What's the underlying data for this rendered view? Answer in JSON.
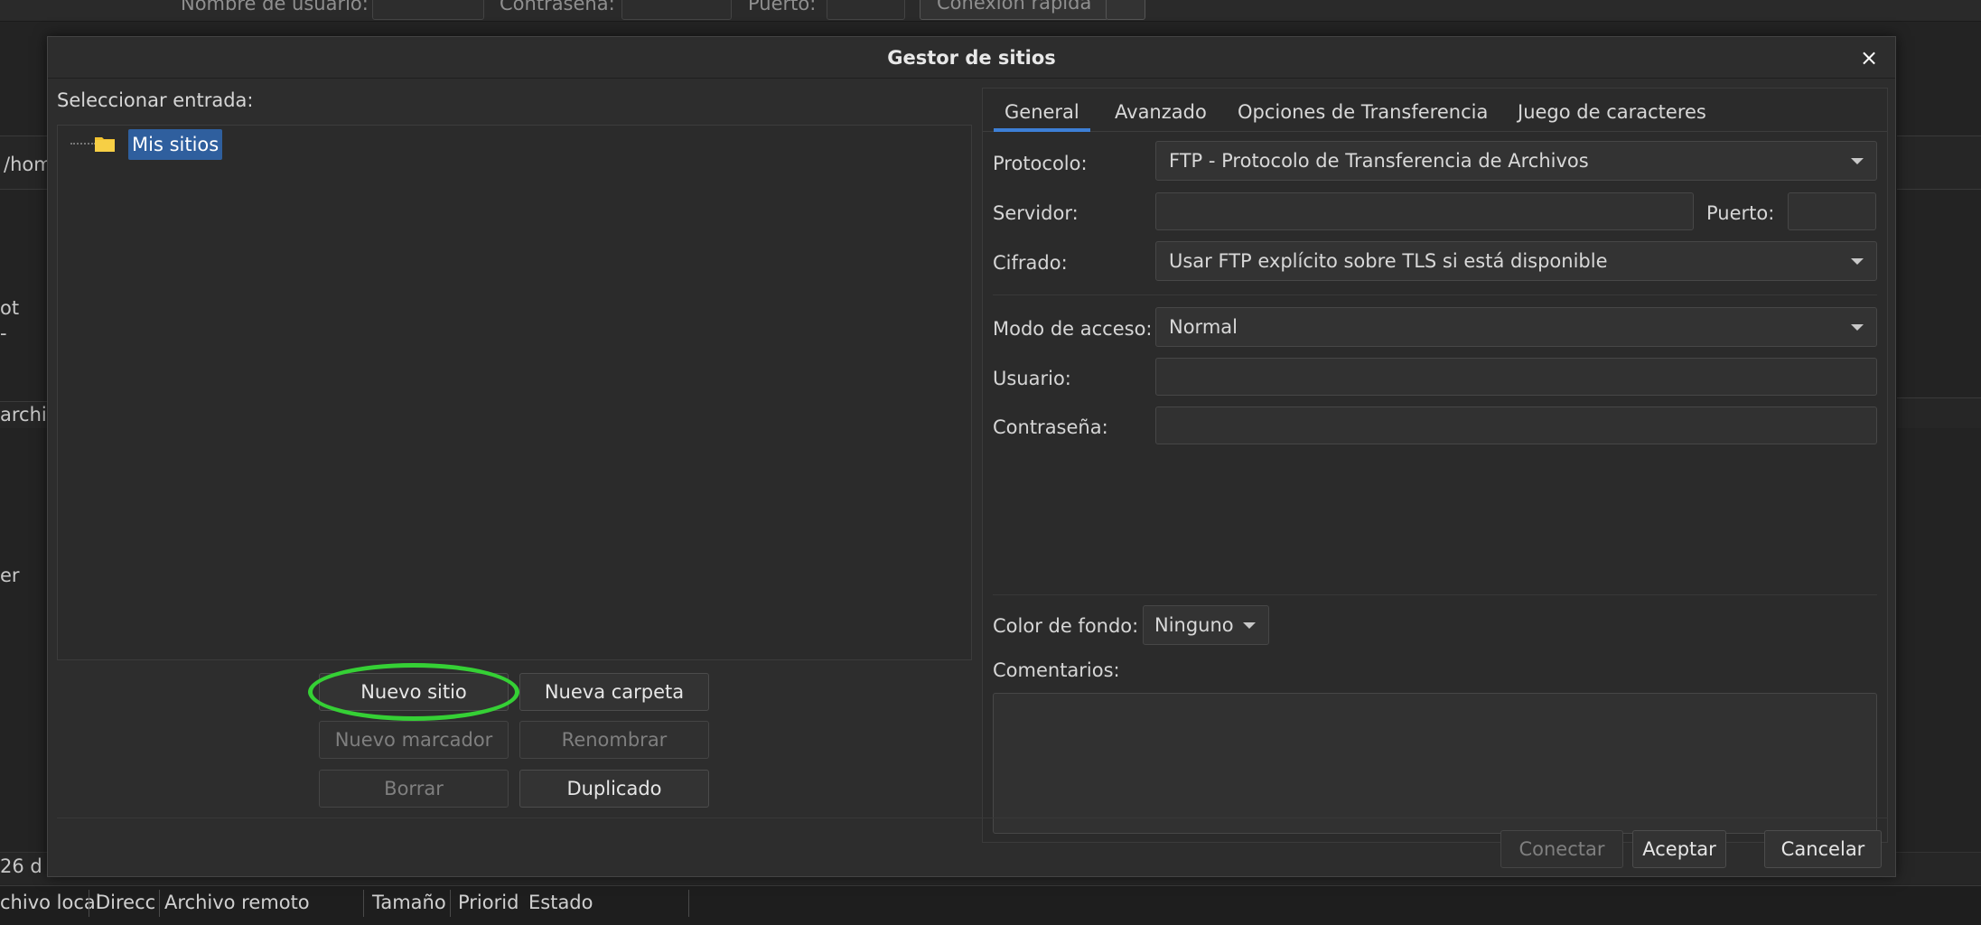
{
  "background": {
    "top_labels": [
      "Nombre de usuario:",
      "Contraseña:",
      "Puerto:"
    ],
    "quick_connect": "Conexión rápida",
    "path_fragment": "/hom",
    "side_fragments": [
      "ot",
      "-",
      "archi",
      "er",
      "26 d"
    ],
    "columns": [
      "chivo local",
      "Direcc",
      "Archivo remoto",
      "Tamaño",
      "Priorid",
      "Estado"
    ]
  },
  "dialog": {
    "title": "Gestor de sitios",
    "close_glyph": "×",
    "select_entry_label": "Seleccionar entrada:",
    "tree": {
      "root_label": "Mis sitios"
    },
    "buttons": {
      "new_site": "Nuevo sitio",
      "new_folder": "Nueva carpeta",
      "new_bookmark": "Nuevo marcador",
      "rename": "Renombrar",
      "delete": "Borrar",
      "duplicate": "Duplicado"
    },
    "tabs": [
      "General",
      "Avanzado",
      "Opciones de Transferencia",
      "Juego de caracteres"
    ],
    "form": {
      "protocol_label": "Protocolo:",
      "protocol_value": "FTP - Protocolo de Transferencia de Archivos",
      "server_label": "Servidor:",
      "server_value": "",
      "port_label": "Puerto:",
      "port_value": "",
      "encryption_label": "Cifrado:",
      "encryption_value": "Usar FTP explícito sobre TLS si está disponible",
      "access_mode_label": "Modo de acceso:",
      "access_mode_value": "Normal",
      "user_label": "Usuario:",
      "user_value": "",
      "password_label": "Contraseña:",
      "password_value": "",
      "bg_color_label": "Color de fondo:",
      "bg_color_value": "Ninguno",
      "comments_label": "Comentarios:",
      "comments_value": ""
    },
    "footer": {
      "connect": "Conectar",
      "accept": "Aceptar",
      "cancel": "Cancelar"
    }
  },
  "colors": {
    "accent": "#3d7fd6",
    "selection": "#2f5f9e",
    "highlight_ring": "#35d035",
    "folder": "#f2c230"
  }
}
